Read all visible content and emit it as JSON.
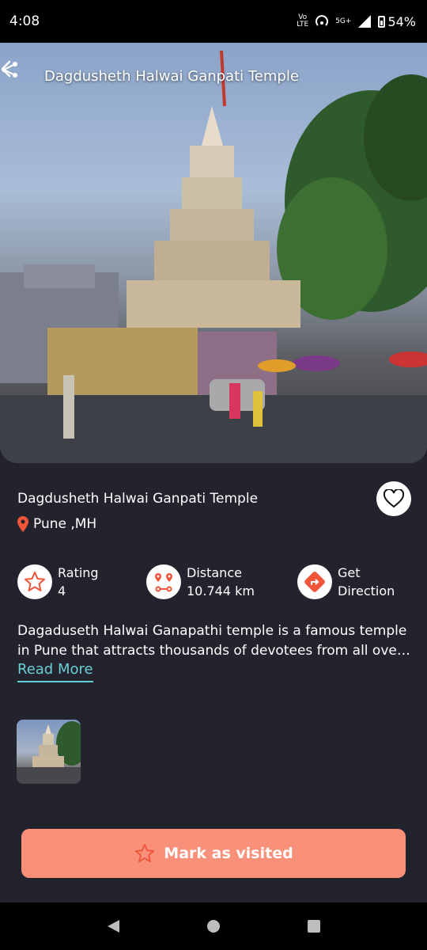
{
  "status": {
    "time": "4:08",
    "network_top": "Vo",
    "network_bottom": "LTE",
    "signal_label": "5G+",
    "battery": "54%"
  },
  "header": {
    "title": "Dagdusheth Halwai Ganpati Temple",
    "back_icon": "chevron-left-icon",
    "share_icon": "share-icon"
  },
  "place": {
    "name": "Dagdusheth Halwai Ganpati Temple",
    "location": "Pune ,MH"
  },
  "stats": {
    "rating_label": "Rating",
    "rating_value": "4",
    "distance_label": "Distance",
    "distance_value": "10.744 km",
    "direction_line1": "Get",
    "direction_line2": "Direction"
  },
  "description": "Dagaduseth Halwai Ganapathi temple is a famous temple in Pune that attracts thousands of devotees from all over the country.",
  "read_more": "Read More",
  "mark_visited": "Mark as visited",
  "colors": {
    "background": "#23232d",
    "accent": "#f8907a",
    "icon_accent": "#f0553a",
    "link": "#68cfd6"
  }
}
